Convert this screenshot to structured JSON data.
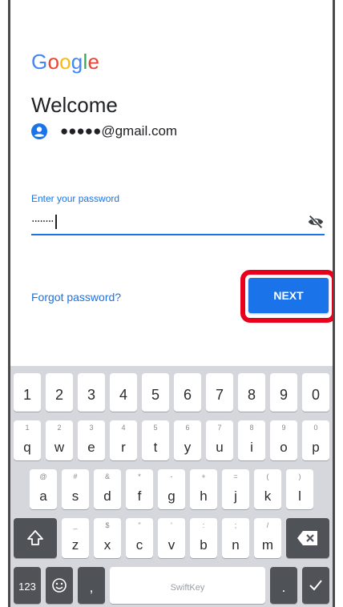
{
  "login": {
    "logo_text": "Google",
    "logo_letters": [
      "G",
      "o",
      "o",
      "g",
      "l",
      "e"
    ],
    "logo_colors": [
      "#4285F4",
      "#EA4335",
      "#FBBC05",
      "#4285F4",
      "#34A853",
      "#EA4335"
    ],
    "welcome": "Welcome",
    "account_email": "●●●●●@gmail.com",
    "password_label": "Enter your password",
    "password_value": "········",
    "forgot_link": "Forgot password?",
    "next_button": "NEXT",
    "highlight_color": "#e8001c",
    "accent_color": "#1a73e8"
  },
  "keyboard": {
    "number_row": [
      "1",
      "2",
      "3",
      "4",
      "5",
      "6",
      "7",
      "8",
      "9",
      "0"
    ],
    "row1": {
      "main": [
        "q",
        "w",
        "e",
        "r",
        "t",
        "y",
        "u",
        "i",
        "o",
        "p"
      ],
      "sub": [
        "1",
        "2",
        "3",
        "4",
        "5",
        "6",
        "7",
        "8",
        "9",
        "0"
      ]
    },
    "row2": {
      "main": [
        "a",
        "s",
        "d",
        "f",
        "g",
        "h",
        "j",
        "k",
        "l"
      ],
      "sub": [
        "@",
        "#",
        "&",
        "*",
        "-",
        "+",
        "=",
        "(",
        ")"
      ]
    },
    "row3": {
      "main": [
        "z",
        "x",
        "c",
        "v",
        "b",
        "n",
        "m"
      ],
      "sub": [
        "_",
        "$",
        "\"",
        "'",
        ":",
        ";",
        "/"
      ]
    },
    "bottom": {
      "symbols": "123",
      "comma": ",",
      "space": "SwiftKey",
      "period": "."
    },
    "icons": [
      "shift-icon",
      "backspace-icon",
      "emoji-icon",
      "enter-check-icon"
    ]
  }
}
